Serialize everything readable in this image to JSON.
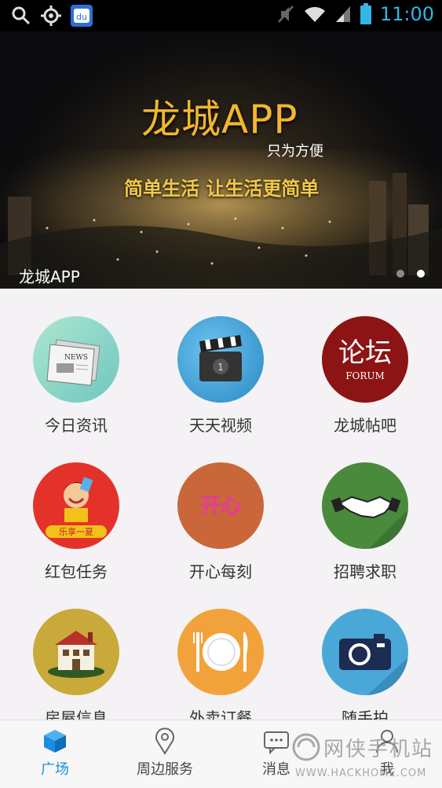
{
  "status_bar": {
    "time": "11:00",
    "icons": [
      "search-icon",
      "gps-icon",
      "baidu-icon",
      "mute-icon",
      "wifi-icon",
      "signal-icon",
      "battery-icon"
    ]
  },
  "banner": {
    "title": "龙城APP",
    "tagline": "只为方便",
    "slogan": "简单生活  让生活更简单",
    "caption": "龙城APP",
    "slides": 2,
    "active_slide": 2
  },
  "grid": {
    "items": [
      {
        "label": "今日资讯",
        "icon": "newspaper-icon",
        "bg": "#8fd6c8"
      },
      {
        "label": "天天视频",
        "icon": "clapperboard-icon",
        "bg": "#4aa8d8"
      },
      {
        "label": "龙城帖吧",
        "icon": "forum-icon",
        "bg": "#8c1414",
        "icon_text": "论坛",
        "icon_subtext": "FORUM"
      },
      {
        "label": "红包任务",
        "icon": "red-packet-icon",
        "bg": "#e4322b",
        "icon_text": "乐享一夏"
      },
      {
        "label": "开心每刻",
        "icon": "happy-icon",
        "bg": "#c9673a",
        "icon_text": "开心"
      },
      {
        "label": "招聘求职",
        "icon": "handshake-icon",
        "bg": "#4a8a3c"
      },
      {
        "label": "房屋信息",
        "icon": "house-icon",
        "bg": "#c9a93a"
      },
      {
        "label": "外卖订餐",
        "icon": "plate-icon",
        "bg": "#f2a23a"
      },
      {
        "label": "随手拍",
        "icon": "camera-icon",
        "bg": "#4aa8d8"
      }
    ]
  },
  "bottom_nav": {
    "items": [
      {
        "label": "广场",
        "icon": "cube-icon",
        "active": true
      },
      {
        "label": "周边服务",
        "icon": "location-pin-icon",
        "active": false
      },
      {
        "label": "消息",
        "icon": "chat-bubble-icon",
        "active": false
      },
      {
        "label": "我",
        "icon": "person-icon",
        "active": false
      }
    ]
  },
  "watermark": {
    "cn": "网侠手机站",
    "en": "WWW.HACKHOME.COM"
  },
  "colors": {
    "accent": "#1a8fe0",
    "status_time": "#33b5e5",
    "banner_title": "#f2b72b"
  }
}
